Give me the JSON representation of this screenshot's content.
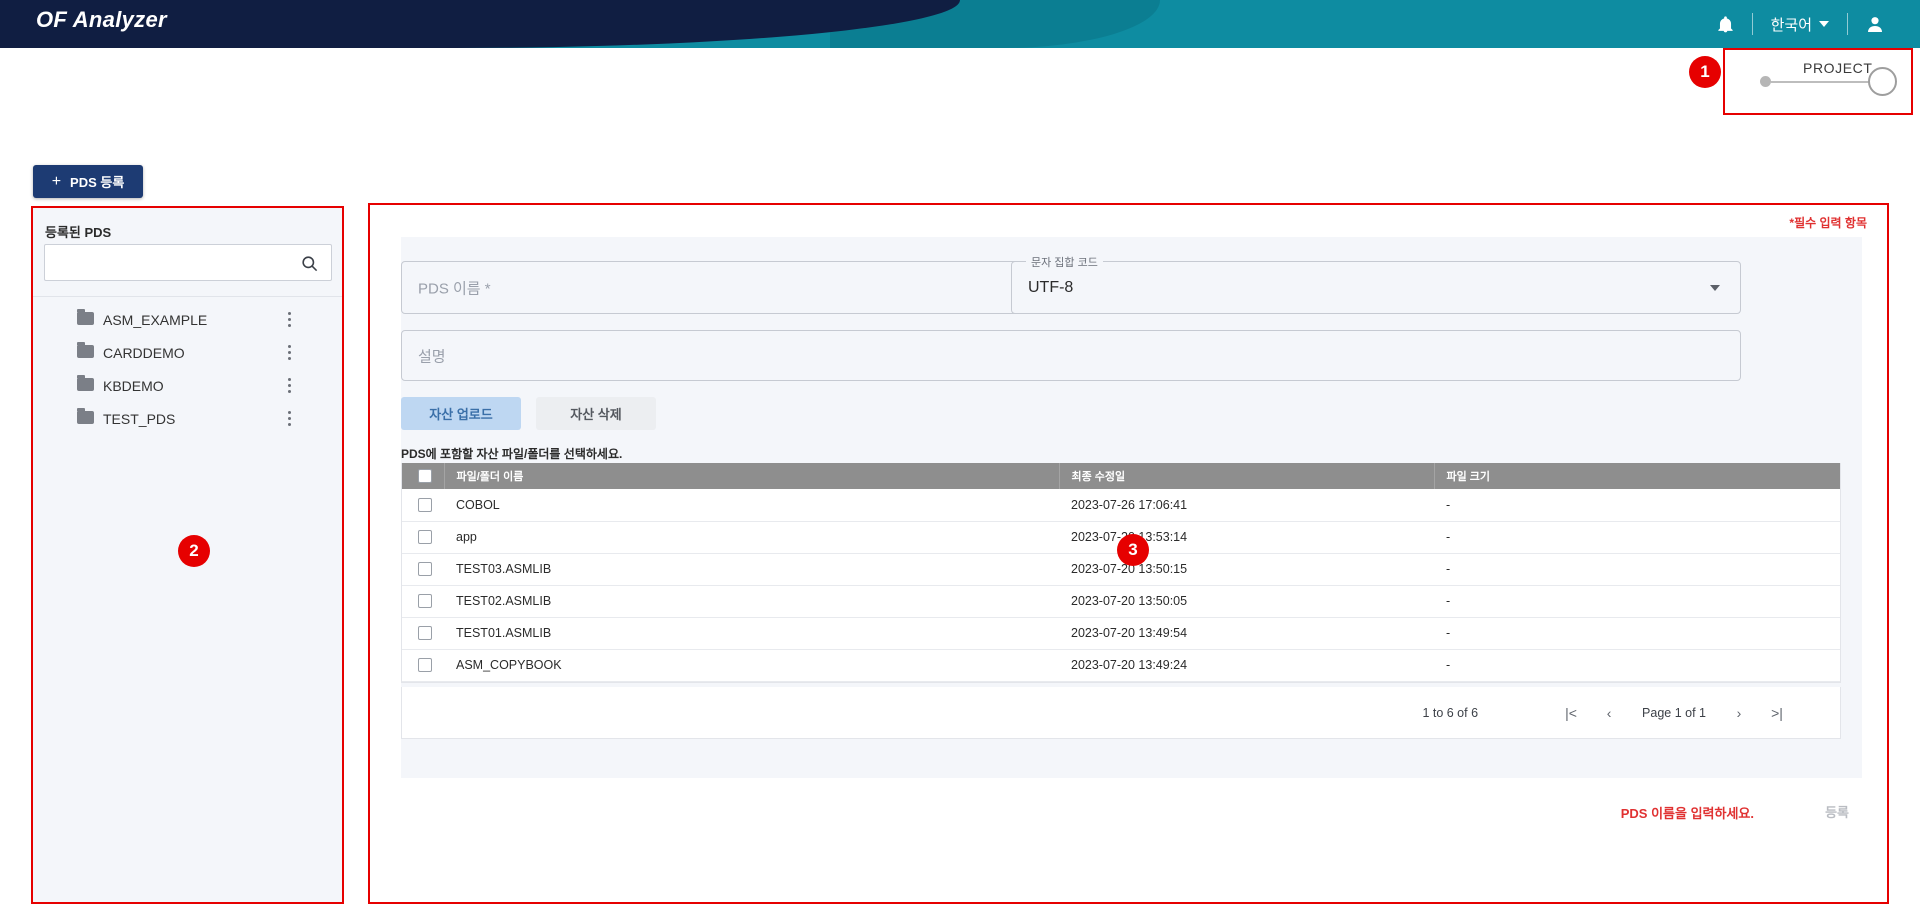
{
  "app": {
    "title": "OF Analyzer"
  },
  "header": {
    "bell_icon": "bell-icon",
    "language": "한국어",
    "user_icon": "user-icon"
  },
  "stepper": {
    "label": "PROJECT",
    "badge": "1"
  },
  "toolbar": {
    "register_pds_label": "PDS 등록",
    "plus": "+"
  },
  "sidebar": {
    "title": "등록된 PDS",
    "search_placeholder": "",
    "search_value": "",
    "search_icon": "search-icon",
    "badge": "2",
    "items": [
      {
        "label": "ASM_EXAMPLE"
      },
      {
        "label": "CARDDEMO"
      },
      {
        "label": "KBDEMO"
      },
      {
        "label": "TEST_PDS"
      }
    ]
  },
  "main": {
    "required_note": "*필수 입력 항목",
    "badge": "3",
    "pds_name": {
      "placeholder": "PDS 이름 *",
      "value": "",
      "error_icon": "error-icon"
    },
    "charset": {
      "legend": "문자 집합 코드",
      "value": "UTF-8"
    },
    "description": {
      "placeholder": "설명",
      "value": ""
    },
    "buttons": {
      "upload": "자산 업로드",
      "delete": "자산 삭제"
    },
    "hint": "PDS에 포함할 자산 파일/폴더를 선택하세요.",
    "table": {
      "columns": [
        "파일/폴더 이름",
        "최종 수정일",
        "파일 크기"
      ],
      "rows": [
        {
          "name": "COBOL",
          "modified": "2023-07-26 17:06:41",
          "size": "-"
        },
        {
          "name": "app",
          "modified": "2023-07-20 13:53:14",
          "size": "-"
        },
        {
          "name": "TEST03.ASMLIB",
          "modified": "2023-07-20 13:50:15",
          "size": "-"
        },
        {
          "name": "TEST02.ASMLIB",
          "modified": "2023-07-20 13:50:05",
          "size": "-"
        },
        {
          "name": "TEST01.ASMLIB",
          "modified": "2023-07-20 13:49:54",
          "size": "-"
        },
        {
          "name": "ASM_COPYBOOK",
          "modified": "2023-07-20 13:49:24",
          "size": "-"
        }
      ]
    },
    "pagination": {
      "count": "1 to 6 of 6",
      "first": "|<",
      "prev": "‹",
      "page_label": "Page 1 of 1",
      "next": "›",
      "last": ">|"
    },
    "footer_message": "PDS 이름을 입력하세요.",
    "submit_label": "등록"
  },
  "colors": {
    "brand_navy": "#101e42",
    "brand_teal": "#0e8ca1",
    "accent_red": "#e60000",
    "button_blue": "#1d3b73"
  }
}
